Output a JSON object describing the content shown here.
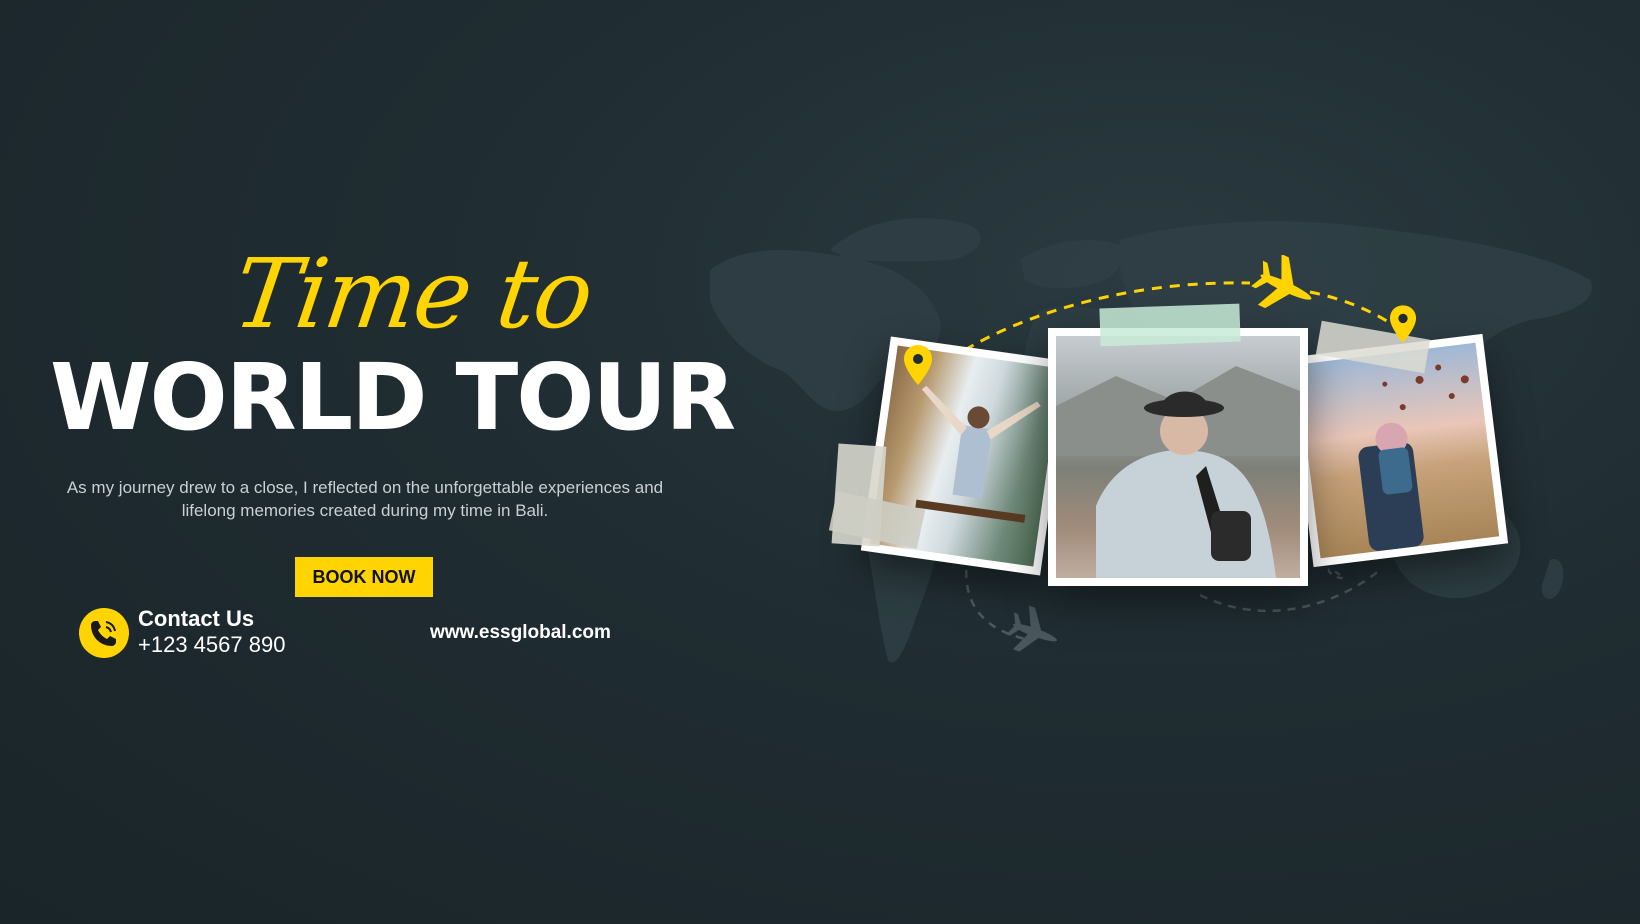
{
  "banner": {
    "script_title": "Time to",
    "main_title": "WORLD TOUR",
    "tagline_line1": "As my journey drew to a close, I reflected on the unforgettable experiences and",
    "tagline_line2": "lifelong memories created during my time in Bali.",
    "cta_label": "BOOK NOW",
    "contact_label": "Contact Us",
    "contact_phone": "+123 4567 890",
    "website": "www.essglobal.com"
  },
  "colors": {
    "background": "#1f2c31",
    "accent": "#ffd400",
    "text": "#ffffff",
    "muted_text": "#c9d0d3"
  },
  "icons": [
    "phone-icon",
    "airplane-icon",
    "location-pin-icon",
    "world-map-graphic"
  ],
  "photos": [
    {
      "subject": "waterfall-swing-photo"
    },
    {
      "subject": "woman-with-hat-mountains-photo"
    },
    {
      "subject": "hot-air-balloons-photo"
    }
  ]
}
